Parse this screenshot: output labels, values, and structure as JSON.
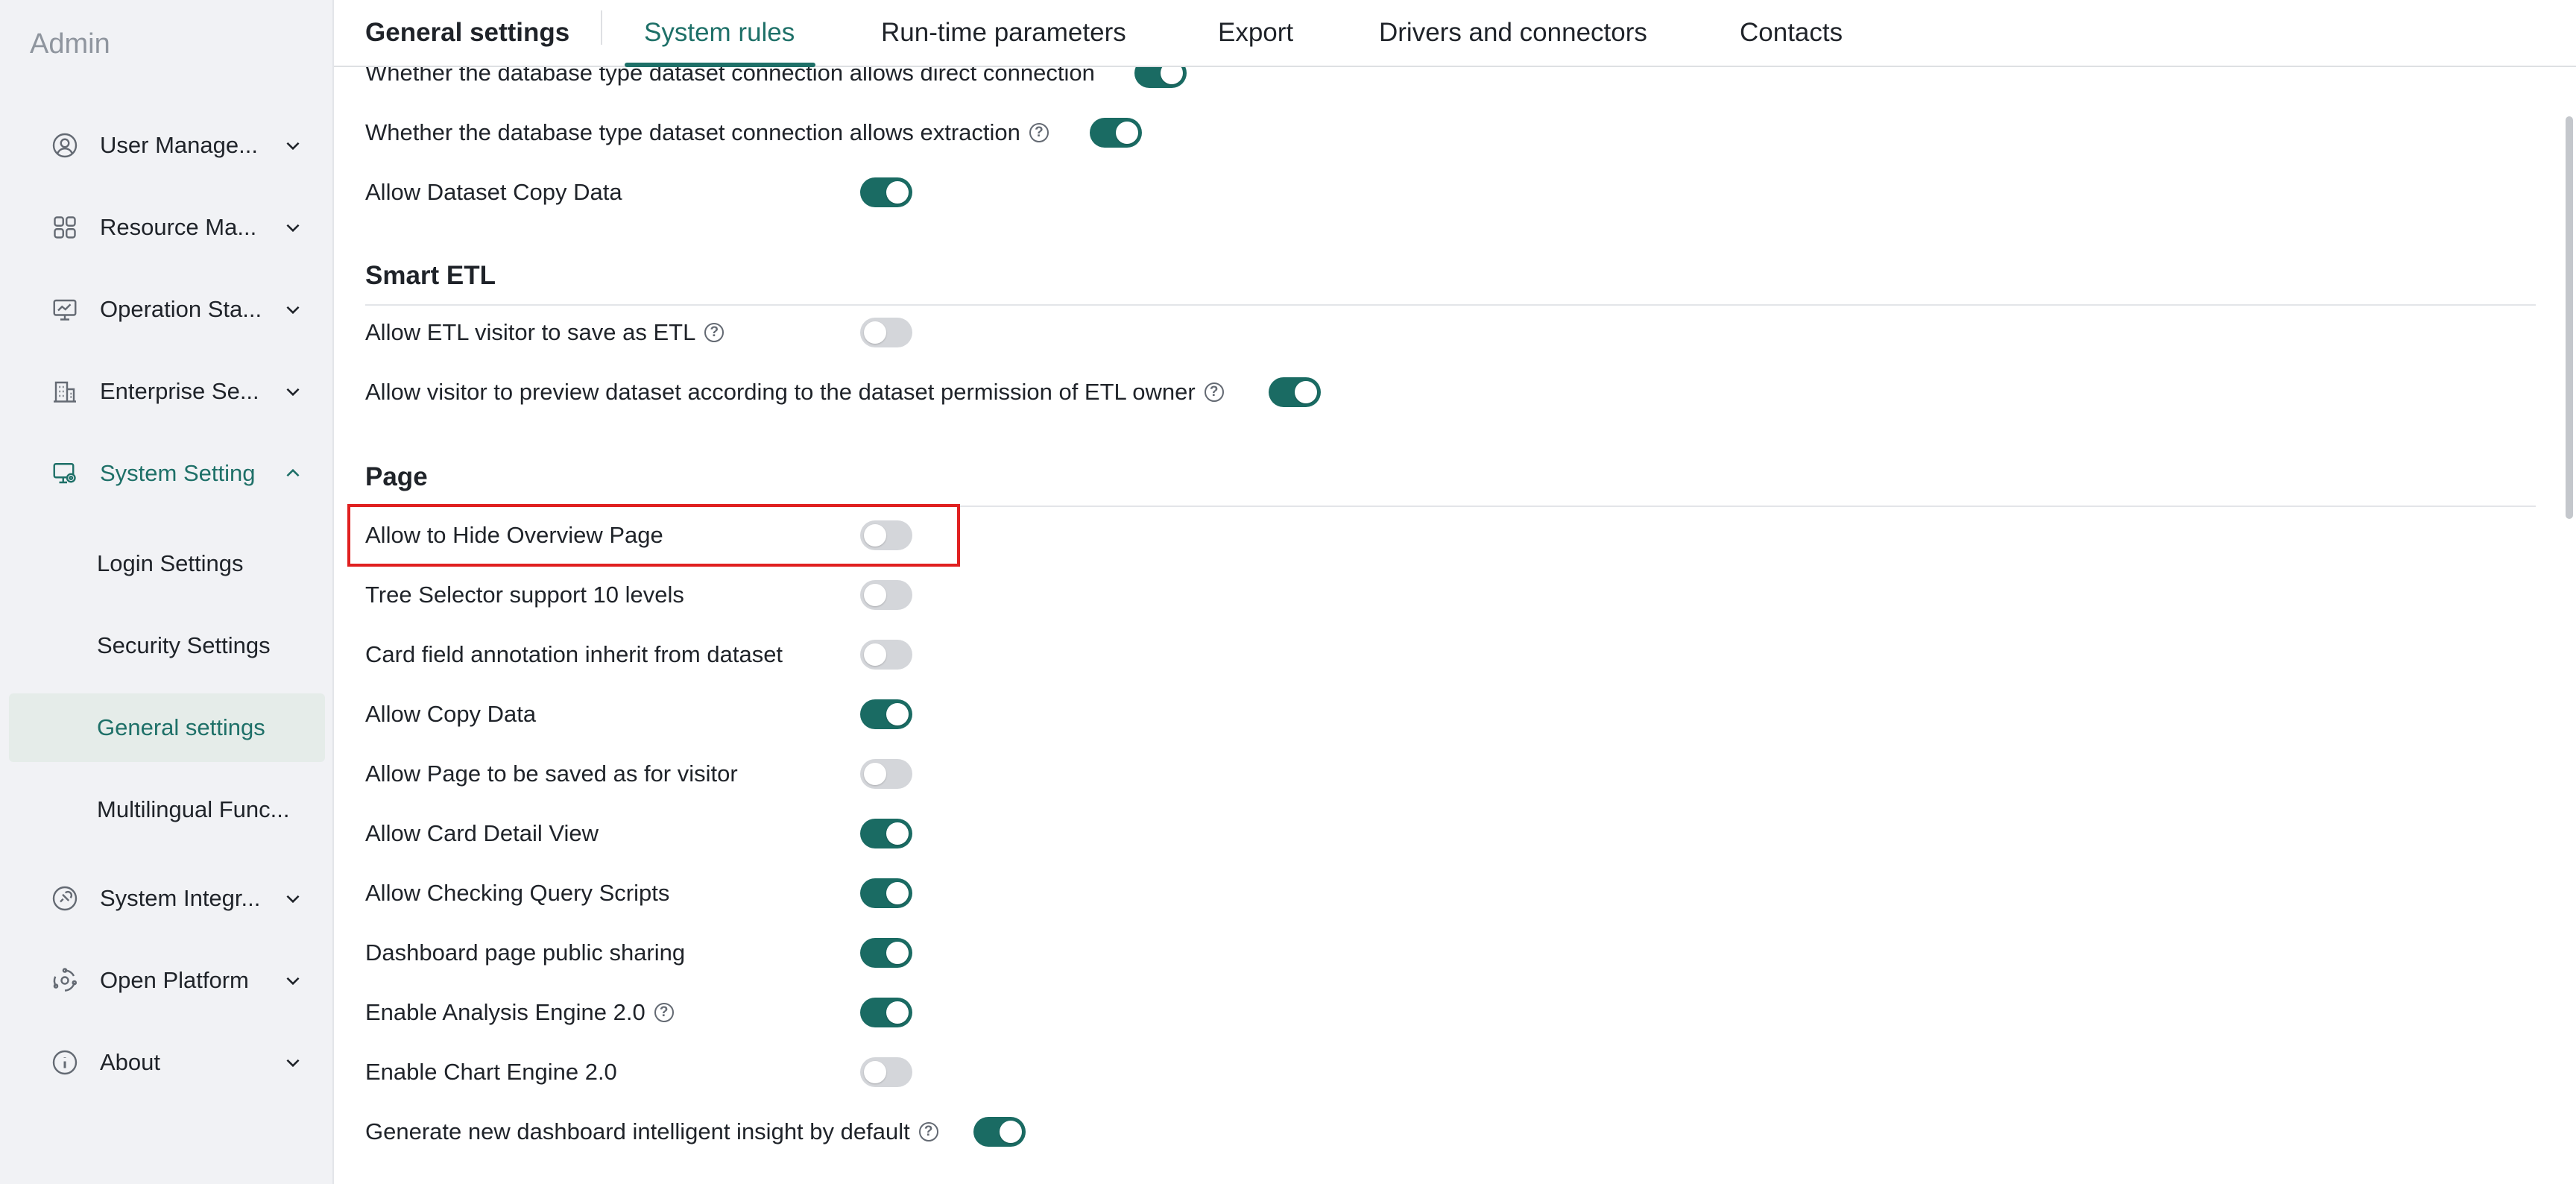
{
  "sidebar": {
    "title": "Admin",
    "items": [
      {
        "label": "User Manage...",
        "icon": "user-icon"
      },
      {
        "label": "Resource Ma...",
        "icon": "grid-icon"
      },
      {
        "label": "Operation Sta...",
        "icon": "monitor-icon"
      },
      {
        "label": "Enterprise Se...",
        "icon": "building-icon"
      },
      {
        "label": "System Setting",
        "icon": "settings-monitor-icon"
      },
      {
        "label": "System Integr...",
        "icon": "integration-icon"
      },
      {
        "label": "Open Platform",
        "icon": "platform-icon"
      },
      {
        "label": "About",
        "icon": "info-icon"
      }
    ],
    "sub_items": [
      {
        "label": "Login Settings"
      },
      {
        "label": "Security Settings"
      },
      {
        "label": "General settings"
      },
      {
        "label": "Multilingual Func..."
      }
    ]
  },
  "tabs": {
    "title": "General settings",
    "items": [
      {
        "label": "System rules"
      },
      {
        "label": "Run-time parameters"
      },
      {
        "label": "Export"
      },
      {
        "label": "Drivers and connectors"
      },
      {
        "label": "Contacts"
      }
    ]
  },
  "dataset_rows": [
    {
      "label": "Whether the database type dataset connection allows direct connection",
      "enabled": true,
      "help": false
    },
    {
      "label": "Whether the database type dataset connection allows extraction",
      "enabled": true,
      "help": true
    },
    {
      "label": "Allow Dataset Copy Data",
      "enabled": true,
      "help": false
    }
  ],
  "smart_etl": {
    "title": "Smart ETL",
    "rows": [
      {
        "label": "Allow ETL visitor to save as ETL",
        "enabled": false,
        "help": true
      },
      {
        "label": "Allow visitor to preview dataset according to the dataset permission of ETL owner",
        "enabled": true,
        "help": true
      }
    ]
  },
  "page": {
    "title": "Page",
    "rows": [
      {
        "label": "Allow to Hide Overview Page",
        "enabled": false,
        "help": false
      },
      {
        "label": "Tree Selector support 10 levels",
        "enabled": false,
        "help": false
      },
      {
        "label": "Card field annotation inherit from dataset",
        "enabled": false,
        "help": false
      },
      {
        "label": "Allow Copy Data",
        "enabled": true,
        "help": false
      },
      {
        "label": "Allow Page to be saved as for visitor",
        "enabled": false,
        "help": false
      },
      {
        "label": "Allow Card Detail View",
        "enabled": true,
        "help": false
      },
      {
        "label": "Allow Checking Query Scripts",
        "enabled": true,
        "help": false
      },
      {
        "label": "Dashboard page public sharing",
        "enabled": true,
        "help": false
      },
      {
        "label": "Enable Analysis Engine 2.0",
        "enabled": true,
        "help": true
      },
      {
        "label": "Enable Chart Engine 2.0",
        "enabled": false,
        "help": false
      },
      {
        "label": "Generate new dashboard intelligent insight by default",
        "enabled": true,
        "help": true
      }
    ]
  },
  "help_glyph": "?",
  "colors": {
    "accent": "#1e7068",
    "toggle_on": "#1a6b63",
    "toggle_off": "#d4d6da",
    "highlight": "#e02020"
  }
}
